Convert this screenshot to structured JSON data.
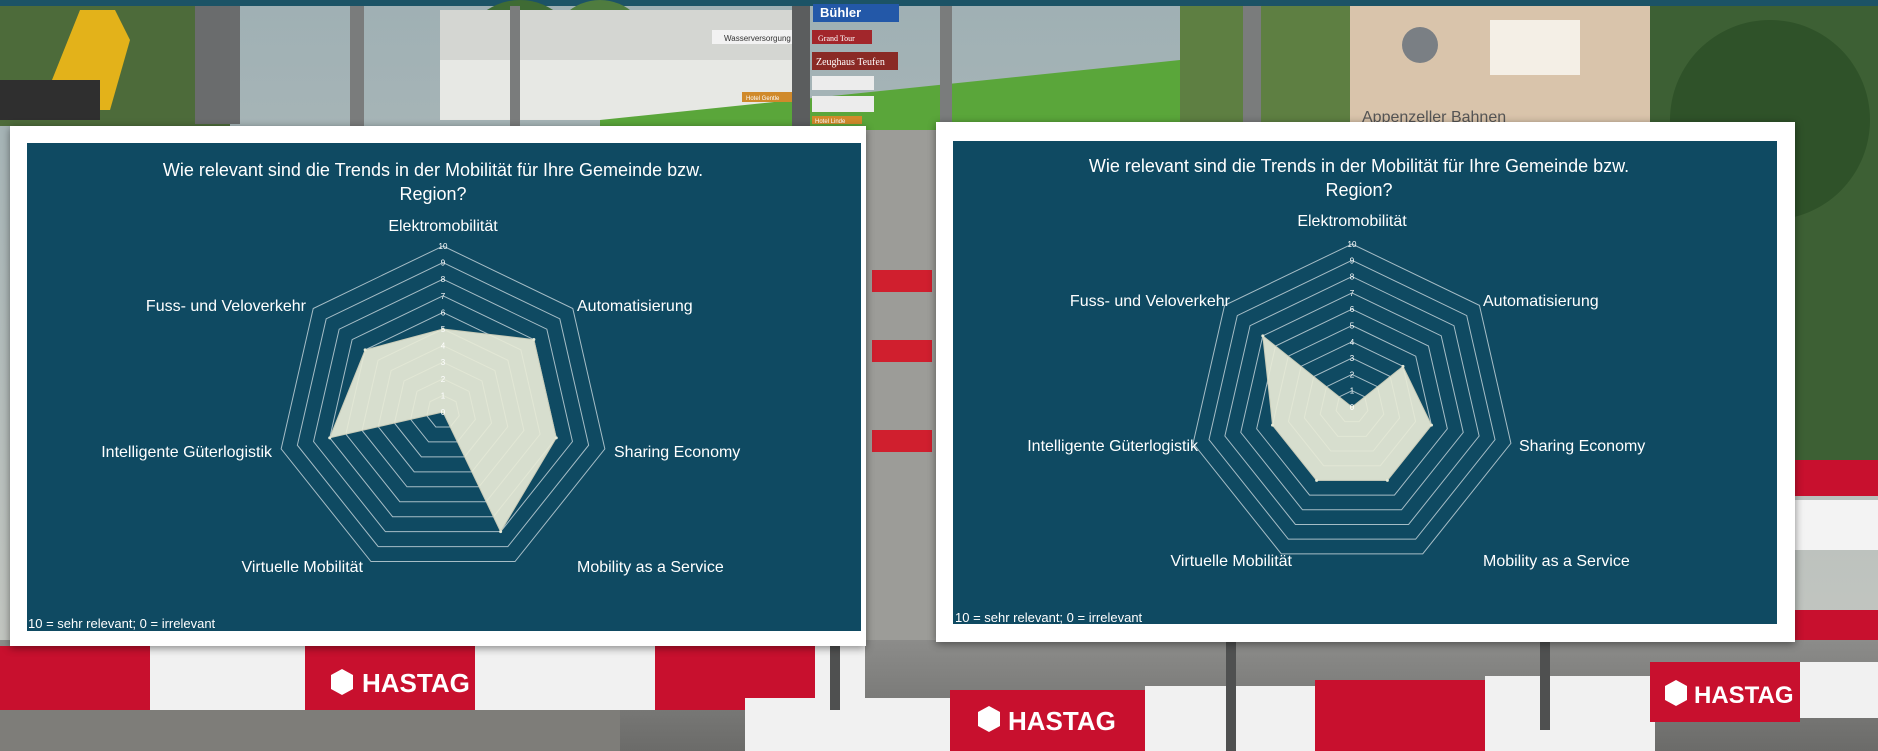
{
  "background": {
    "signs": {
      "buhler": "Bühler",
      "wasserversorgung": "Wasserversorgung",
      "grand_tour": "Grand Tour",
      "zeughaus": "Zeughaus Teufen",
      "hotel_gentle": "Hotel Gentle",
      "hotel_linde": "Hotel Linde",
      "appenzeller": "Appenzeller Bahnen"
    },
    "barrier_brand": "HASTAG"
  },
  "colors": {
    "panel_bg": "#0f4a62",
    "radar_fill": "#e6e9d6",
    "grid": "#d9e4e8",
    "text": "#ffffff",
    "barrier_red": "#c8102e"
  },
  "chart_data": [
    {
      "type": "radar",
      "title": "Wie relevant sind die Trends in der Mobilität für Ihre Gemeinde bzw. Region?",
      "categories": [
        "Elektromobilität",
        "Automatisierung",
        "Sharing Economy",
        "Mobility as a Service",
        "Virtuelle Mobilität",
        "Intelligente Güterlogistik",
        "Fuss- und Veloverkehr"
      ],
      "values": [
        5,
        7,
        7,
        8,
        0,
        7,
        6
      ],
      "rlim": [
        0,
        10
      ],
      "ticks": [
        "0",
        "1",
        "2",
        "3",
        "4",
        "5",
        "6",
        "7",
        "8",
        "9",
        "10"
      ],
      "note": "10 = sehr relevant; 0 = irrelevant",
      "grid": true
    },
    {
      "type": "radar",
      "title": "Wie relevant sind die Trends in der Mobilität für Ihre Gemeinde bzw. Region?",
      "categories": [
        "Elektromobilität",
        "Automatisierung",
        "Sharing Economy",
        "Mobility as a Service",
        "Virtuelle Mobilität",
        "Intelligente Güterlogistik",
        "Fuss- und Veloverkehr"
      ],
      "values": [
        0,
        4,
        5,
        5,
        5,
        5,
        7
      ],
      "rlim": [
        0,
        10
      ],
      "ticks": [
        "0",
        "1",
        "2",
        "3",
        "4",
        "5",
        "6",
        "7",
        "8",
        "9",
        "10"
      ],
      "note": "10 = sehr relevant; 0 = irrelevant",
      "grid": true
    }
  ]
}
